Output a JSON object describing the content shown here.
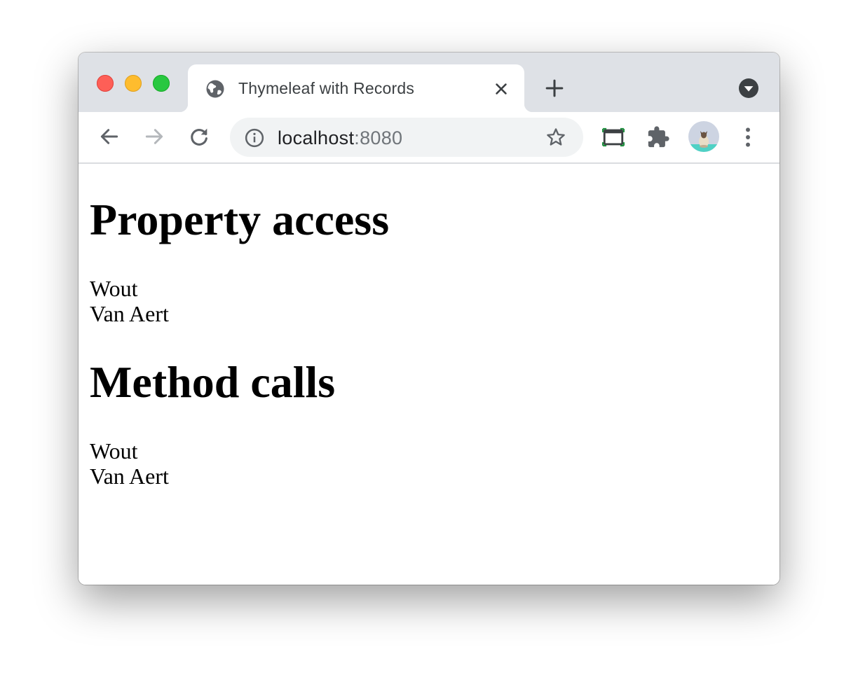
{
  "browser": {
    "tab": {
      "title": "Thymeleaf with Records"
    },
    "address": {
      "host": "localhost",
      "port": ":8080"
    }
  },
  "page": {
    "sections": [
      {
        "heading": "Property access",
        "first_name": "Wout",
        "last_name": "Van Aert"
      },
      {
        "heading": "Method calls",
        "first_name": "Wout",
        "last_name": "Van Aert"
      }
    ]
  },
  "icons": {
    "favicon": "globe-icon",
    "tab_close": "close-icon",
    "new_tab": "plus-icon",
    "tab_search": "chevron-down-circle-icon",
    "back": "arrow-left-icon",
    "forward": "arrow-right-icon",
    "reload": "reload-icon",
    "site_info": "info-icon",
    "bookmark": "star-icon",
    "cast": "cast-icon",
    "extensions": "puzzle-icon",
    "profile": "avatar",
    "menu": "kebab-menu-icon"
  },
  "colors": {
    "titlebar": "#dee1e6",
    "omnibox": "#f1f3f4",
    "close_traffic": "#fe5f57",
    "minimize_traffic": "#febc2e",
    "zoom_traffic": "#28c840",
    "cast_accent": "#1e8e3e"
  }
}
